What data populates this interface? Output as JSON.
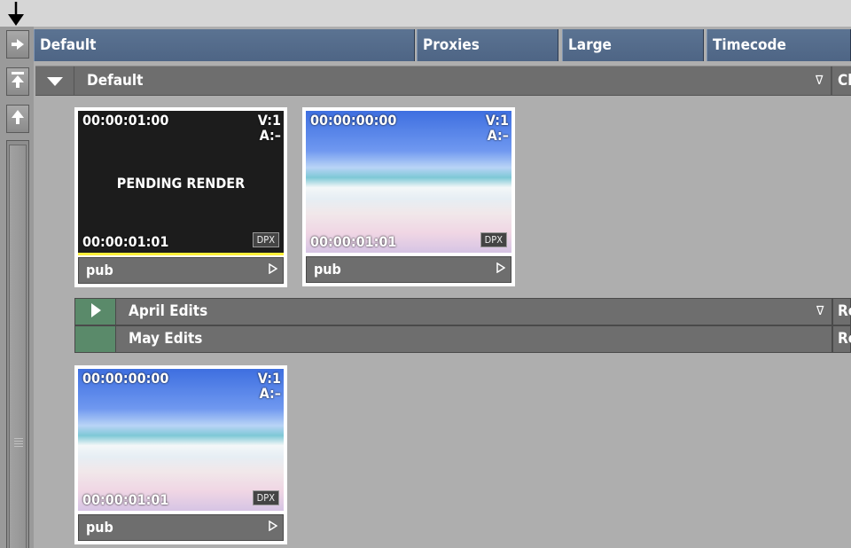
{
  "header": {
    "columns": [
      {
        "label": "Default"
      },
      {
        "label": "Proxies"
      },
      {
        "label": "Large"
      },
      {
        "label": "Timecode"
      }
    ]
  },
  "group": {
    "label": "Default",
    "dropdown_icon": "∇",
    "cut_text": "Cl"
  },
  "clips": [
    {
      "tc_start": "00:00:01:00",
      "video": "V:1",
      "audio": "A:–",
      "center_text": "PENDING RENDER",
      "tc_end": "00:00:01:01",
      "format": "DPX",
      "name": "pub",
      "thumbnail": "black"
    },
    {
      "tc_start": "00:00:00:00",
      "video": "V:1",
      "audio": "A:–",
      "center_text": "",
      "tc_end": "00:00:01:01",
      "format": "DPX",
      "name": "pub",
      "thumbnail": "beach"
    },
    {
      "tc_start": "00:00:00:00",
      "video": "V:1",
      "audio": "A:–",
      "center_text": "",
      "tc_end": "00:00:01:01",
      "format": "DPX",
      "name": "pub",
      "thumbnail": "beach"
    }
  ],
  "reels": [
    {
      "label": "April Edits",
      "dropdown_icon": "∇",
      "cut_text": "Re",
      "expanded": false
    },
    {
      "label": "May Edits",
      "dropdown_icon": "",
      "cut_text": "Re"
    }
  ],
  "icons": {
    "top_arrow": "arrow-down-icon",
    "rail_expand": "arrow-right-icon",
    "rail_top": "scroll-to-top-icon",
    "rail_up": "scroll-up-icon",
    "grip": "grip-icon",
    "play": "play-icon"
  },
  "colors": {
    "header_blue": "#5b7392",
    "pending_yellow": "#ffef3a",
    "reel_green": "#5a8a6a"
  }
}
